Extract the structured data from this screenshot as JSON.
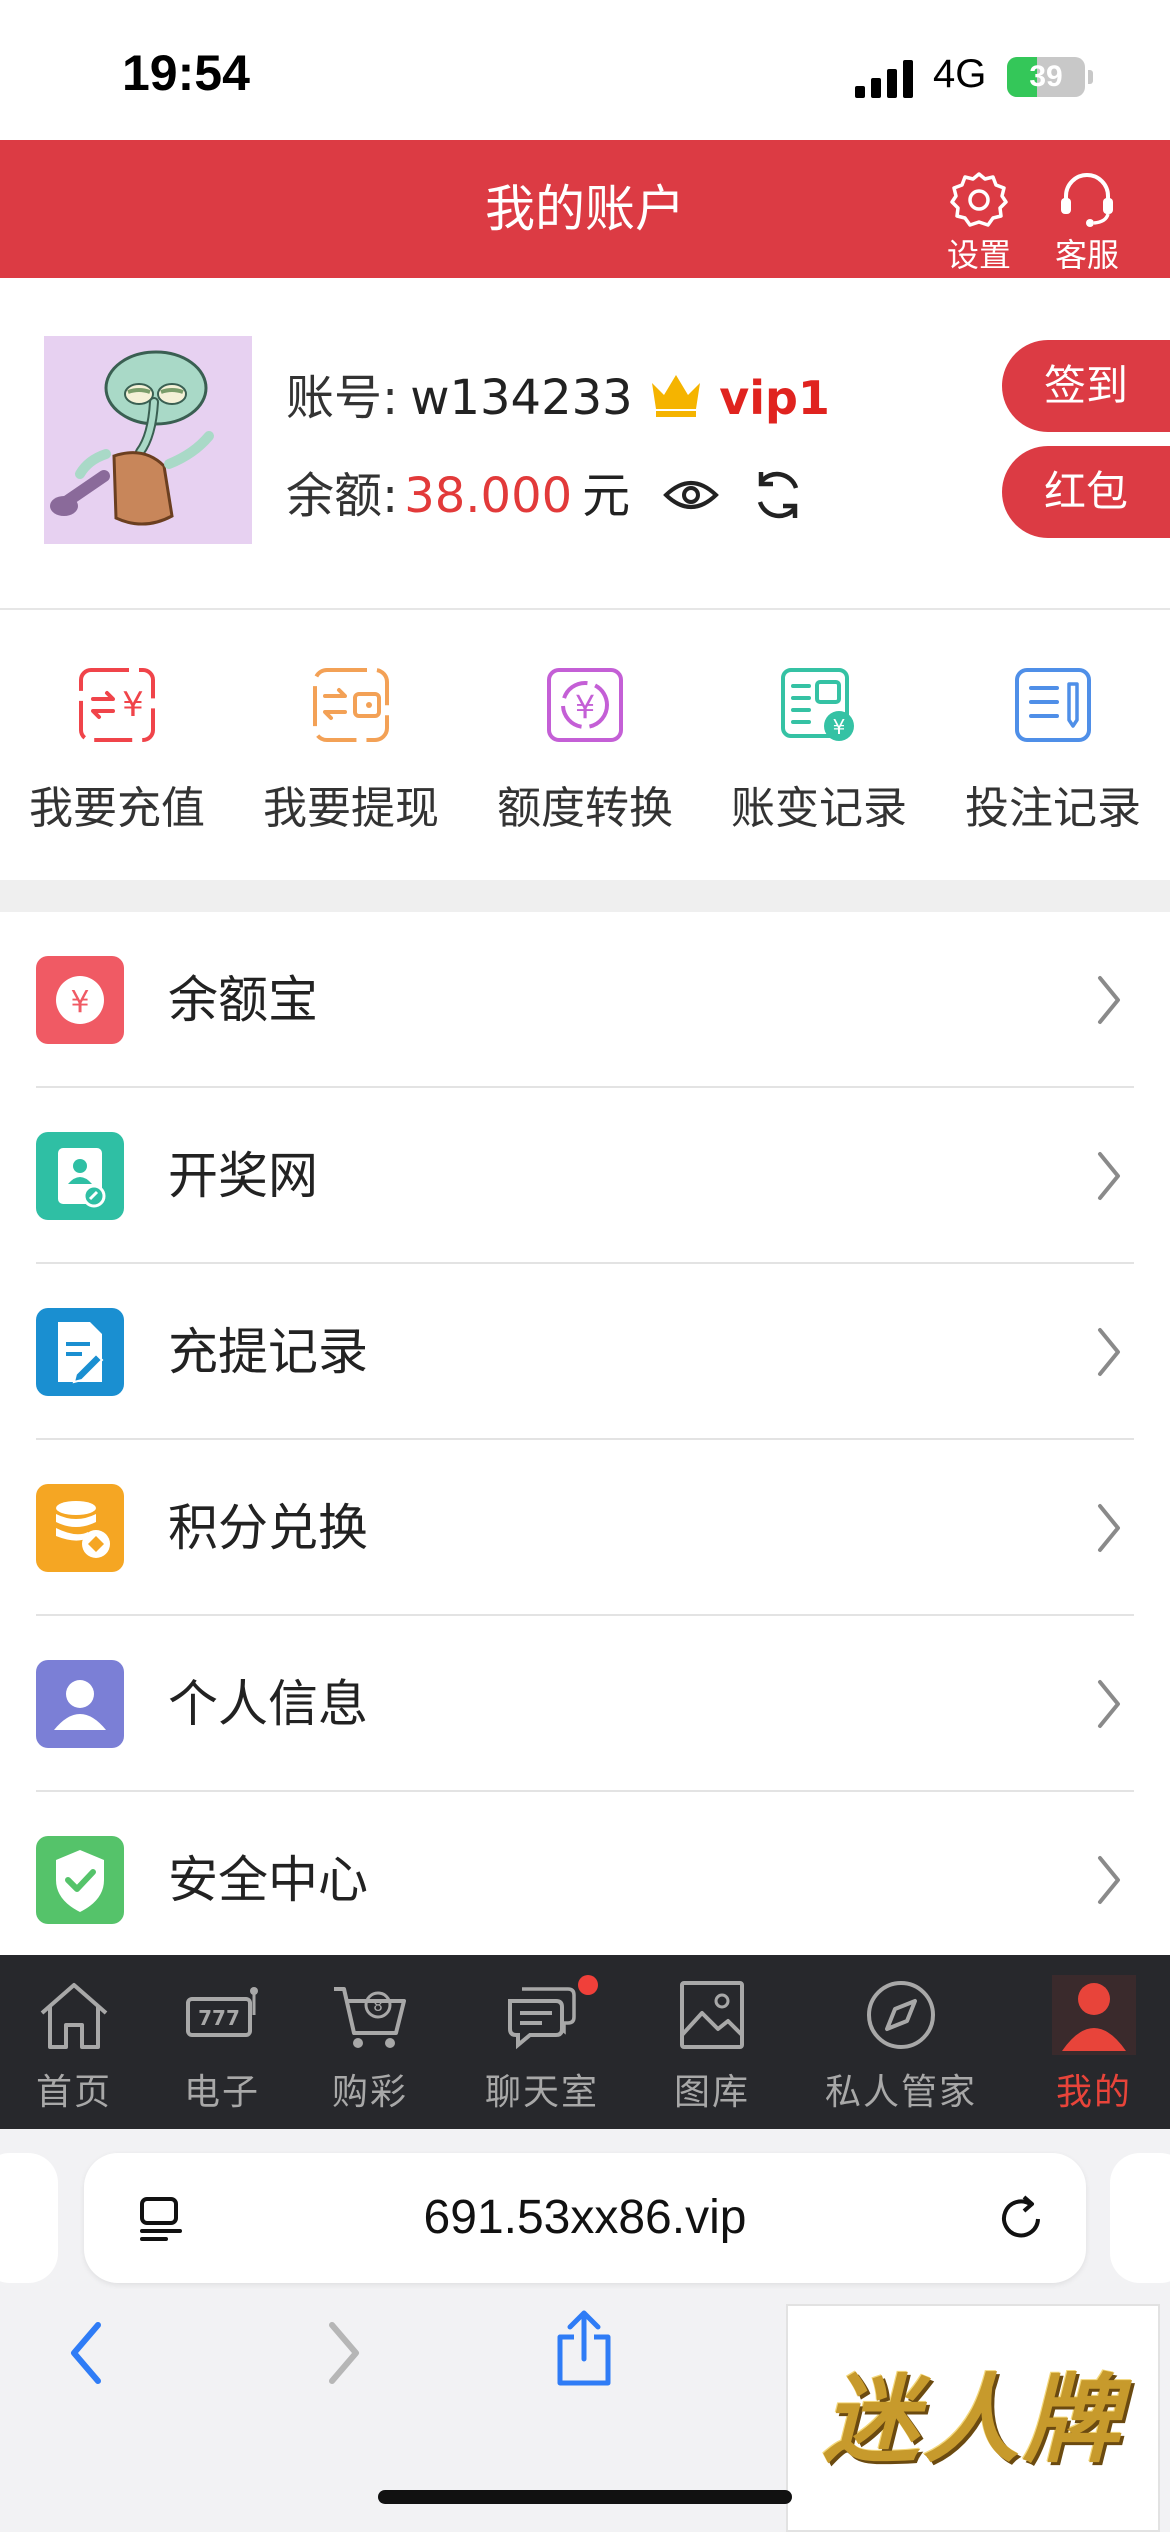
{
  "status_bar": {
    "time": "19:54",
    "network": "4G",
    "battery": "39",
    "battery_level": 0.39
  },
  "header": {
    "title": "我的账户",
    "settings_label": "设置",
    "service_label": "客服"
  },
  "account": {
    "username_label": "账号:",
    "username": "w134233",
    "vip_label": "vip1",
    "balance_label": "余额:",
    "balance": "38.000",
    "currency": "元",
    "signin_label": "签到",
    "redpacket_label": "红包"
  },
  "quick_actions": [
    {
      "label": "我要充值",
      "icon": "deposit-icon",
      "color": "#f0444a"
    },
    {
      "label": "我要提现",
      "icon": "withdraw-icon",
      "color": "#f3a156"
    },
    {
      "label": "额度转换",
      "icon": "transfer-icon",
      "color": "#c45fd6"
    },
    {
      "label": "账变记录",
      "icon": "ledger-icon",
      "color": "#35c2a4"
    },
    {
      "label": "投注记录",
      "icon": "bet-record-icon",
      "color": "#4f8fe8"
    }
  ],
  "menu": [
    {
      "label": "余额宝",
      "icon": "yuan-coin-icon",
      "color": "#f05a64"
    },
    {
      "label": "开奖网",
      "icon": "profile-card-icon",
      "color": "#2fbfa4"
    },
    {
      "label": "充提记录",
      "icon": "document-edit-icon",
      "color": "#1a8fd1"
    },
    {
      "label": "积分兑换",
      "icon": "coin-stack-icon",
      "color": "#f5a623"
    },
    {
      "label": "个人信息",
      "icon": "person-icon",
      "color": "#7b7fd6"
    },
    {
      "label": "安全中心",
      "icon": "shield-check-icon",
      "color": "#55c36a"
    }
  ],
  "tabs": [
    {
      "label": "首页",
      "icon": "home-icon"
    },
    {
      "label": "电子",
      "icon": "slot-machine-icon"
    },
    {
      "label": "购彩",
      "icon": "cart-icon"
    },
    {
      "label": "聊天室",
      "icon": "chat-icon"
    },
    {
      "label": "图库",
      "icon": "gallery-icon"
    },
    {
      "label": "私人管家",
      "icon": "compass-icon"
    },
    {
      "label": "我的",
      "icon": "user-icon"
    }
  ],
  "browser": {
    "url": "691.53xx86.vip",
    "watermark": "迷人牌"
  },
  "colors": {
    "brand_red": "#dc3b44",
    "tabbar_bg": "#27282c",
    "active_tab": "#e8443a",
    "balance": "#e23a3a"
  }
}
